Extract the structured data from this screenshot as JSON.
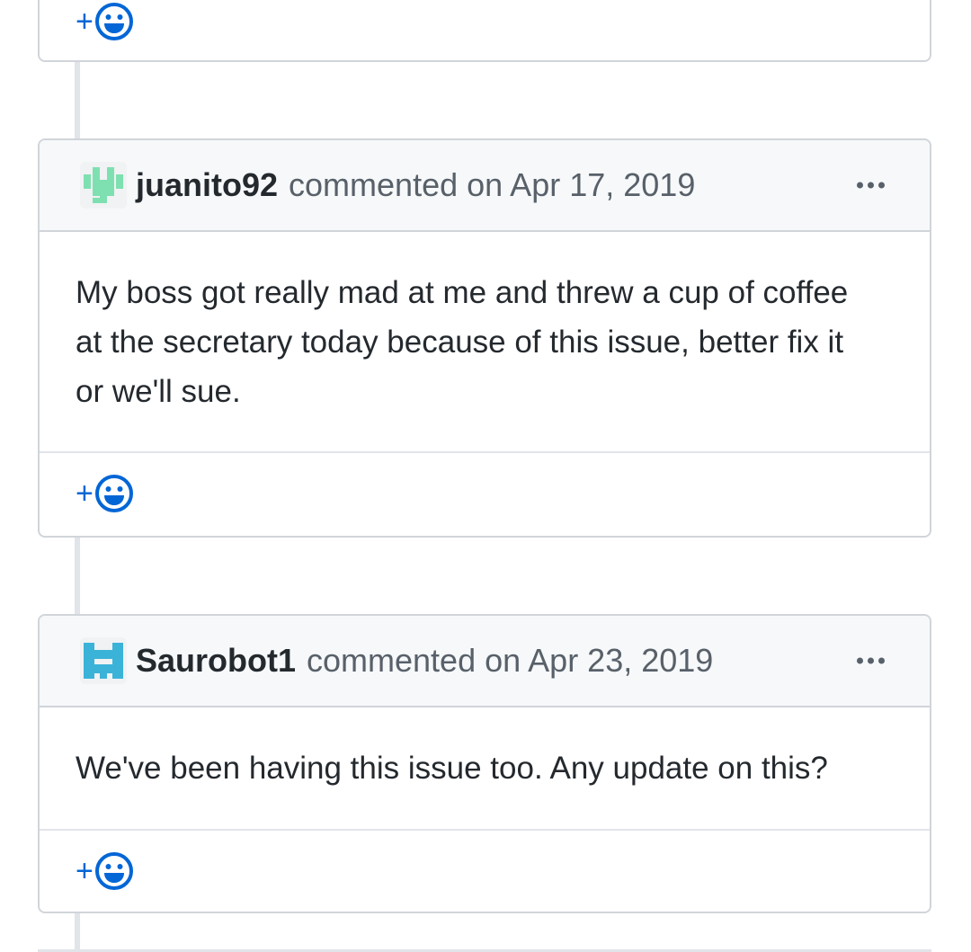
{
  "colors": {
    "link": "#0366d6",
    "header_bg": "#f6f8fa",
    "border": "#d1d5da",
    "muted": "#586069",
    "juanito_avatar": "#7ee0b0",
    "saurobot_avatar": "#3bb3d9"
  },
  "top_card": {
    "reaction": {
      "plus": "+",
      "icon": "smiley-icon"
    }
  },
  "comments": [
    {
      "author": "juanito92",
      "action": "commented on Apr 17, 2019",
      "body": "My boss got really mad at me and threw a cup of coffee at the secretary today because of this issue, better fix it or we'll sue.",
      "reaction": {
        "plus": "+",
        "icon": "smiley-icon"
      },
      "more_icon": "kebab-horizontal-icon"
    },
    {
      "author": "Saurobot1",
      "action": "commented on Apr 23, 2019",
      "body": "We've been having this issue too. Any update on this?",
      "reaction": {
        "plus": "+",
        "icon": "smiley-icon"
      },
      "more_icon": "kebab-horizontal-icon"
    }
  ]
}
